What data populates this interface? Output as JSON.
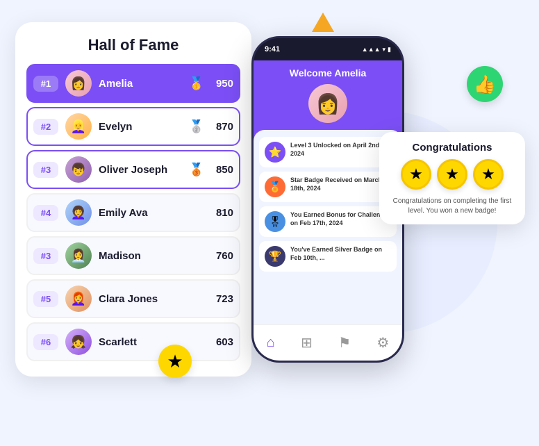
{
  "page": {
    "background_color": "#f0f4ff"
  },
  "hall_of_fame": {
    "title": "Hall of Fame",
    "rows": [
      {
        "rank": "#1",
        "name": "Amelia",
        "score": "950",
        "medal": "🥇",
        "style": "highlighted",
        "avatar": "av1"
      },
      {
        "rank": "#2",
        "name": "Evelyn",
        "score": "870",
        "medal": "🥈",
        "style": "bordered",
        "avatar": "av2"
      },
      {
        "rank": "#3",
        "name": "Oliver Joseph",
        "score": "850",
        "medal": "🥉",
        "style": "bordered",
        "avatar": "av3"
      },
      {
        "rank": "#4",
        "name": "Emily Ava",
        "score": "810",
        "medal": "",
        "style": "plain",
        "avatar": "av4"
      },
      {
        "rank": "#3",
        "name": "Madison",
        "score": "760",
        "medal": "",
        "style": "plain",
        "avatar": "av5"
      },
      {
        "rank": "#5",
        "name": "Clara Jones",
        "score": "723",
        "medal": "",
        "style": "plain",
        "avatar": "av6"
      },
      {
        "rank": "#6",
        "name": "Scarlett",
        "score": "603",
        "medal": "",
        "style": "plain",
        "avatar": "av7"
      }
    ]
  },
  "phone": {
    "time": "9:41",
    "signal": "▲▲▲",
    "wifi": "wifi",
    "battery": "battery",
    "welcome_text": "Welcome Amelia",
    "activities": [
      {
        "icon": "⭐",
        "icon_style": "purple",
        "text": "Level 3 Unlocked on April 2nd, 2024"
      },
      {
        "icon": "🏅",
        "icon_style": "orange",
        "text": "Star Badge Received on March 18th, 2024"
      },
      {
        "icon": "🎖",
        "icon_style": "blue",
        "text": "You Earned Bonus for Challenge on Feb 17th, 2024"
      },
      {
        "icon": "🏆",
        "icon_style": "dark",
        "text": "You've Earned Silver Badge on Feb 10th, ..."
      }
    ],
    "navbar": [
      {
        "icon": "⌂",
        "label": "home",
        "active": true
      },
      {
        "icon": "⊞",
        "label": "grid",
        "active": false
      },
      {
        "icon": "⚑",
        "label": "flag",
        "active": false
      },
      {
        "icon": "⚙",
        "label": "settings",
        "active": false
      }
    ]
  },
  "congrats": {
    "title": "Congratulations",
    "stars_count": 3,
    "star_icon": "★",
    "text": "Congratulations on completing the first level. You won a new badge!"
  },
  "decorations": {
    "thumbs_up": "👍",
    "star": "★"
  }
}
